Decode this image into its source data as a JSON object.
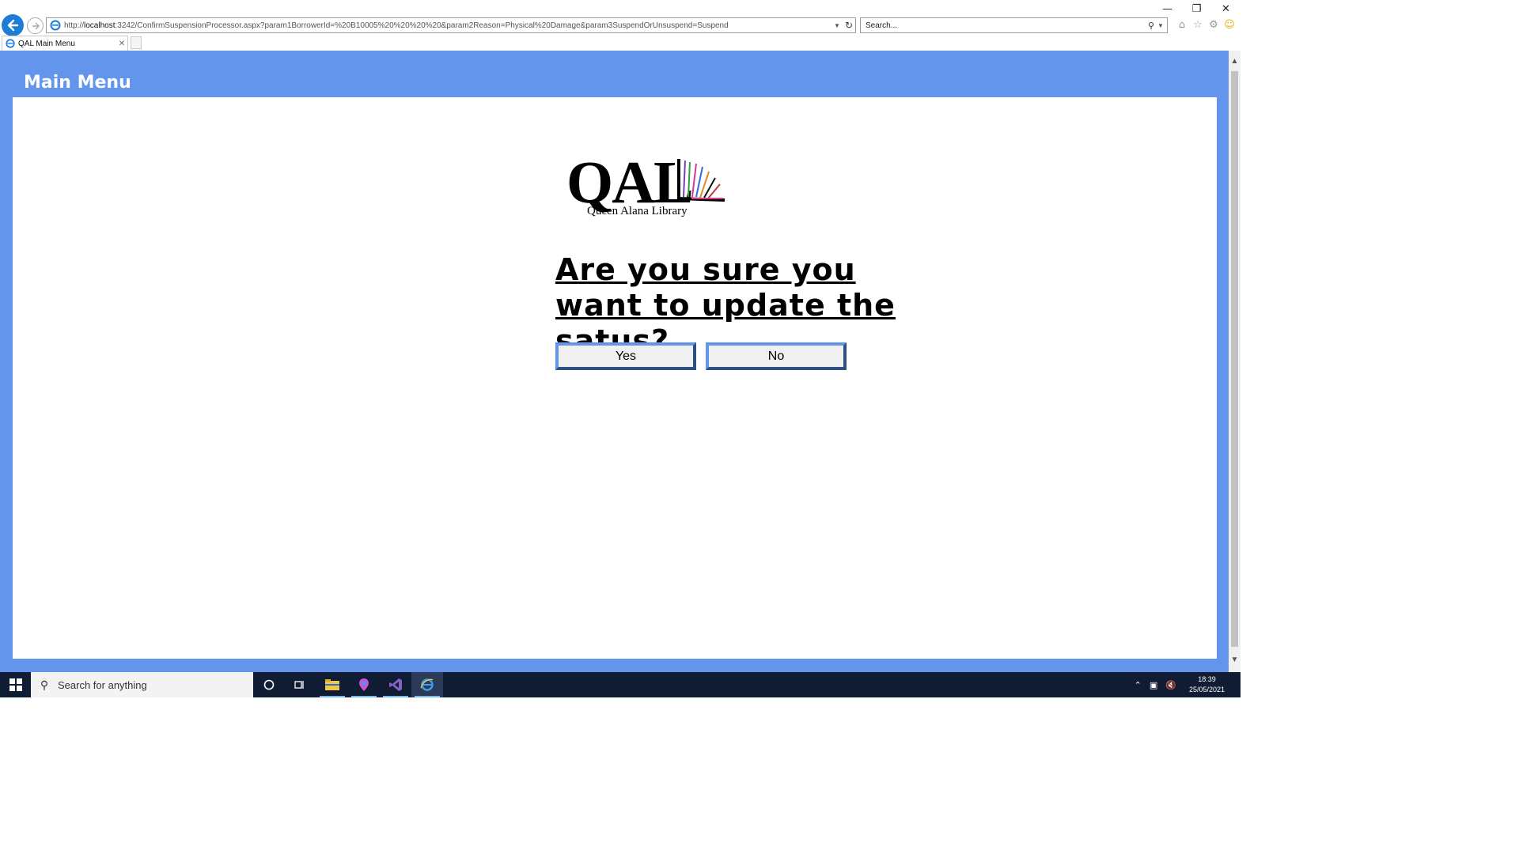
{
  "browser": {
    "url_prefix": "http://",
    "url_host": "localhost",
    "url_rest": ":3242/ConfirmSuspensionProcessor.aspx?param1BorrowerId=%20B10005%20%20%20%20&param2Reason=Physical%20Damage&param3SuspendOrUnsuspend=Suspend",
    "search_placeholder": "Search...",
    "tab_title": "QAL Main Menu"
  },
  "page": {
    "header": "Main Menu",
    "logo_text": "QAL",
    "logo_subtitle": "Queen Alana Library",
    "question": "Are you sure you want to update the satus?",
    "yes_label": "Yes",
    "no_label": "No"
  },
  "taskbar": {
    "search_placeholder": "Search for anything",
    "time": "18:39",
    "date": "25/05/2021"
  },
  "colors": {
    "page_background": "#6495ed",
    "taskbar": "#101c33",
    "back_button": "#1c7cd6"
  }
}
